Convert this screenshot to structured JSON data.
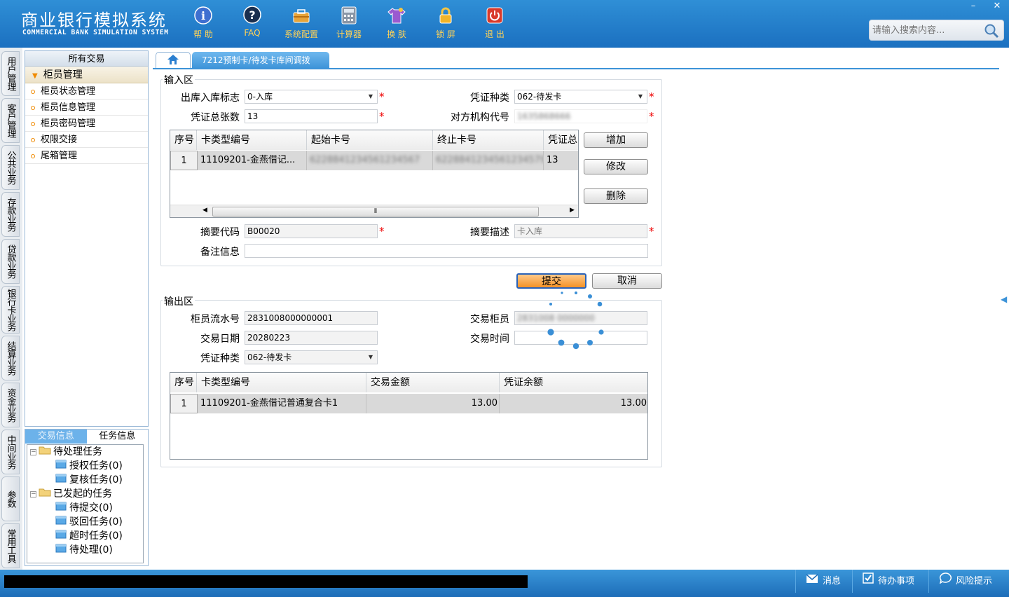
{
  "header": {
    "title": "商业银行模拟系统",
    "subtitle": "COMMERCIAL BANK SIMULATION SYSTEM",
    "tools": [
      {
        "label": "帮 助",
        "icon": "info-icon"
      },
      {
        "label": "FAQ",
        "icon": "help-icon"
      },
      {
        "label": "系统配置",
        "icon": "toolbox-icon"
      },
      {
        "label": "计算器",
        "icon": "calculator-icon"
      },
      {
        "label": "换 肤",
        "icon": "shirt-icon"
      },
      {
        "label": "锁 屏",
        "icon": "lock-icon"
      },
      {
        "label": "退 出",
        "icon": "power-icon"
      }
    ],
    "window_controls": {
      "minimize": "–",
      "close": "✕"
    },
    "search_placeholder": "请输入搜索内容..."
  },
  "vertical_tabs": [
    "用户管理",
    "客户管理",
    "公共业务",
    "存款业务",
    "贷款业务",
    "银行卡业务",
    "结算业务",
    "资金业务",
    "中间业务",
    "参数",
    "常用工具"
  ],
  "left_panel": {
    "header": "所有交易",
    "group": "柜员管理",
    "items": [
      "柜员状态管理",
      "柜员信息管理",
      "柜员密码管理",
      "权限交接",
      "尾箱管理"
    ]
  },
  "task_panel": {
    "tabs": [
      "交易信息",
      "任务信息"
    ],
    "tree": {
      "pending": "待处理任务",
      "pending_children": [
        "授权任务(0)",
        "复核任务(0)"
      ],
      "initiated": "已发起的任务",
      "initiated_children": [
        "待提交(0)",
        "驳回任务(0)",
        "超时任务(0)",
        "待处理(0)"
      ]
    }
  },
  "tabs": {
    "active": "7212预制卡/待发卡库间调拨"
  },
  "input_section": {
    "legend": "输入区",
    "fields": {
      "direction_label": "出库入库标志",
      "direction_value": "0-入库",
      "voucher_type_label": "凭证种类",
      "voucher_type_value": "062-待发卡",
      "total_label": "凭证总张数",
      "total_value": "13",
      "counterparty_label": "对方机构代号",
      "counterparty_value": "1635868666",
      "summary_code_label": "摘要代码",
      "summary_code_value": "B00020",
      "summary_desc_label": "摘要描述",
      "summary_desc_value": "卡入库",
      "remark_label": "备注信息",
      "remark_value": ""
    },
    "grid": {
      "headers": [
        "序号",
        "卡类型编号",
        "起始卡号",
        "终止卡号",
        "凭证总"
      ],
      "rows": [
        {
          "no": "1",
          "card_type": "11109201-金燕借记...",
          "start": "6228841234561234567",
          "end": "6228841234561234579",
          "total": "13"
        }
      ]
    },
    "buttons": {
      "add": "增加",
      "edit": "修改",
      "delete": "删除"
    }
  },
  "actions": {
    "submit": "提交",
    "cancel": "取消"
  },
  "output_section": {
    "legend": "输出区",
    "fields": {
      "serial_label": "柜员流水号",
      "serial_value": "2831008000000001",
      "teller_label": "交易柜员",
      "teller_value": "2831008 0000000",
      "date_label": "交易日期",
      "date_value": "20280223",
      "time_label": "交易时间",
      "time_value": "",
      "voucher_type_label": "凭证种类",
      "voucher_type_value": "062-待发卡"
    },
    "grid": {
      "headers": [
        "序号",
        "卡类型编号",
        "交易金额",
        "凭证余额"
      ],
      "rows": [
        {
          "no": "1",
          "card_type": "11109201-金燕借记普通复合卡1",
          "amount": "13.00",
          "balance": "13.00"
        }
      ]
    }
  },
  "statusbar": {
    "message": "消息",
    "todo": "待办事项",
    "risk": "风险提示"
  },
  "colors": {
    "header_blue": "#1b70c0",
    "accent_orange": "#f59227",
    "required_red": "#e00000",
    "spinner_blue": "#3a8fd6"
  }
}
